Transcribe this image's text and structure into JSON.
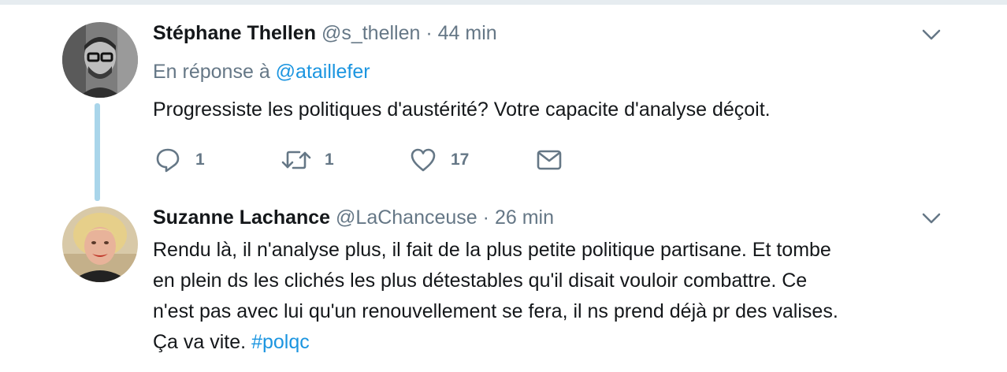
{
  "tweets": [
    {
      "fullname": "Stéphane Thellen",
      "username": "@s_thellen",
      "separator": "·",
      "time": "44 min",
      "reply_prefix": "En réponse à",
      "reply_mention": "@ataillefer",
      "text": "Progressiste les politiques d'austérité? Votre capacite d'analyse déçoit.",
      "actions": {
        "reply_count": "1",
        "retweet_count": "1",
        "like_count": "17"
      }
    },
    {
      "fullname": "Suzanne Lachance",
      "username": "@LaChanceuse",
      "separator": "·",
      "time": "26 min",
      "text_lines": [
        "Rendu là, il n'analyse plus, il fait de la plus petite politique partisane. Et tombe",
        "en plein ds les clichés les plus détestables qu'il disait vouloir combattre. Ce",
        "n'est pas avec lui qu'un renouvellement se fera, il ns prend déjà pr des valises."
      ],
      "text_last_line": "Ça va vite.",
      "hashtag": "#polqc"
    }
  ],
  "icons": {
    "more": "chevron-down-icon",
    "reply": "reply-icon",
    "retweet": "retweet-icon",
    "like": "heart-icon",
    "dm": "envelope-icon"
  },
  "colors": {
    "link": "#1b95e0",
    "muted": "#657786",
    "text": "#14171a",
    "thread_line": "#a9d5ea"
  }
}
